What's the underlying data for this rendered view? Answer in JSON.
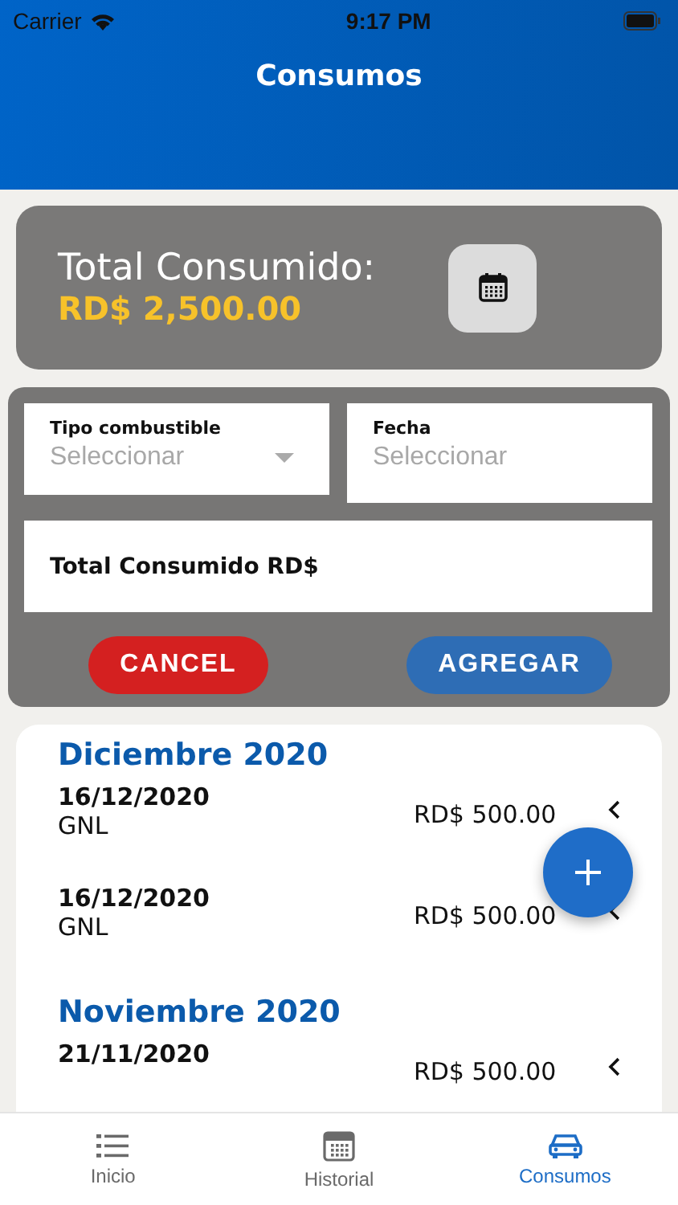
{
  "status_bar": {
    "carrier": "Carrier",
    "time": "9:17 PM"
  },
  "header": {
    "title": "Consumos"
  },
  "summary": {
    "label": "Total Consumido:",
    "amount": "RD$ 2,500.00"
  },
  "form": {
    "fields": [
      {
        "kind": "dropdown",
        "label": "Tipo combustible",
        "placeholder": "Seleccionar"
      },
      {
        "kind": "date",
        "label": "Fecha",
        "placeholder": "Seleccionar"
      },
      {
        "kind": "text",
        "label": "Total Consumido RD$"
      }
    ],
    "buttons": [
      {
        "kind": "cancel",
        "label": "CANCEL"
      },
      {
        "kind": "primary",
        "label": "AGREGAR"
      }
    ]
  },
  "sections": [
    {
      "month": "Diciembre 2020",
      "items": [
        {
          "date": "16/12/2020",
          "fuel": "GNL",
          "amount": "RD$ 500.00"
        },
        {
          "date": "16/12/2020",
          "fuel": "GNL",
          "amount": "RD$ 500.00"
        }
      ]
    },
    {
      "month": "Noviembre 2020",
      "items": [
        {
          "date": "21/11/2020",
          "amount": "RD$ 500.00"
        }
      ]
    }
  ],
  "tab_bar": [
    {
      "kind": "list",
      "label": "Inicio",
      "selected": false
    },
    {
      "kind": "calendar",
      "label": "Historial",
      "selected": false
    },
    {
      "kind": "car",
      "label": "Consumos",
      "selected": true
    }
  ]
}
